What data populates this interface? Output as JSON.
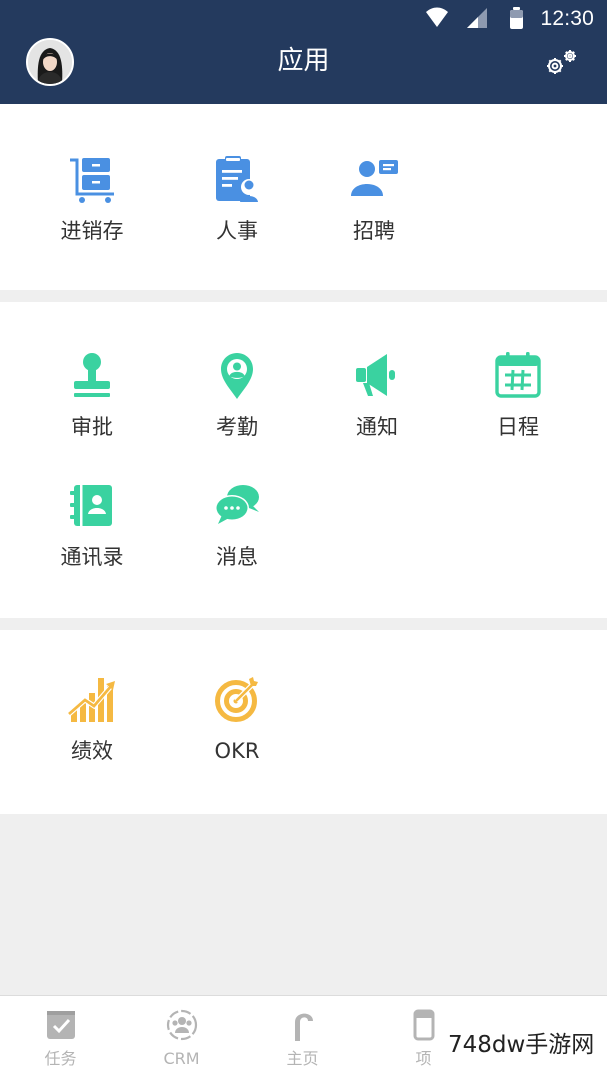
{
  "status_bar": {
    "time": "12:30",
    "icons": [
      "wifi-icon",
      "cell-signal-icon",
      "battery-icon"
    ]
  },
  "header": {
    "title": "应用",
    "avatar": "user-avatar",
    "settings_icon": "settings-gears-icon",
    "background_color": "#243a5e"
  },
  "sections": [
    {
      "items": [
        {
          "label": "进销存",
          "icon": "inventory-cart-icon",
          "color": "#4a90e2"
        },
        {
          "label": "人事",
          "icon": "personnel-clipboard-icon",
          "color": "#4a90e2"
        },
        {
          "label": "招聘",
          "icon": "recruitment-person-card-icon",
          "color": "#4a90e2"
        }
      ]
    },
    {
      "items": [
        {
          "label": "审批",
          "icon": "approval-stamp-icon",
          "color": "#3ad2a0"
        },
        {
          "label": "考勤",
          "icon": "attendance-location-pin-icon",
          "color": "#3ad2a0"
        },
        {
          "label": "通知",
          "icon": "notice-megaphone-icon",
          "color": "#3ad2a0"
        },
        {
          "label": "日程",
          "icon": "schedule-calendar-icon",
          "color": "#3ad2a0"
        },
        {
          "label": "通讯录",
          "icon": "contacts-book-icon",
          "color": "#3ad2a0"
        },
        {
          "label": "消息",
          "icon": "messages-chat-bubbles-icon",
          "color": "#3ad2a0"
        }
      ]
    },
    {
      "items": [
        {
          "label": "绩效",
          "icon": "performance-bar-chart-icon",
          "color": "#f5b942"
        },
        {
          "label": "OKR",
          "icon": "okr-target-icon",
          "color": "#f5b942"
        }
      ]
    }
  ],
  "tabbar": {
    "tabs": [
      {
        "label": "任务",
        "icon": "task-check-icon"
      },
      {
        "label": "CRM",
        "icon": "crm-people-icon"
      },
      {
        "label": "主页",
        "icon": "home-arch-icon"
      },
      {
        "label": "项",
        "icon": "project-icon"
      }
    ],
    "inactive_color": "#b4b4b4"
  },
  "watermark": "748dw手游网"
}
